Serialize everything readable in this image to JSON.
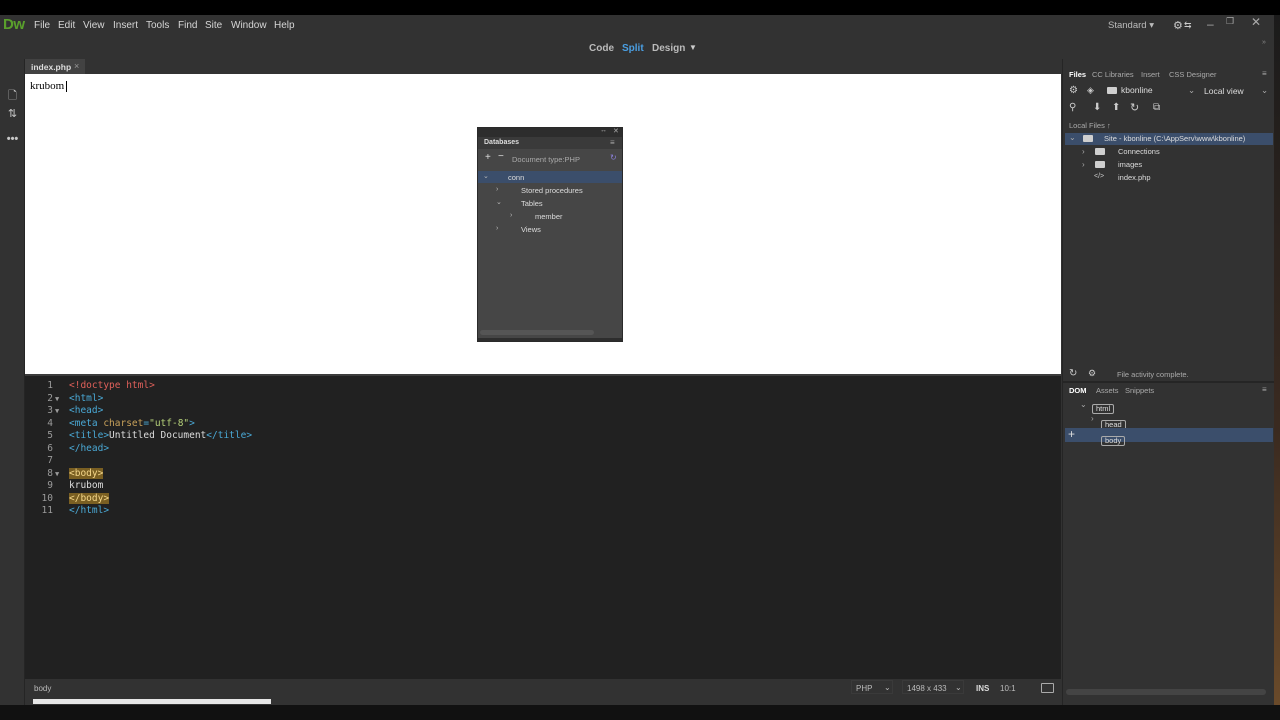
{
  "app": {
    "logo": "Dw"
  },
  "menu": [
    "File",
    "Edit",
    "View",
    "Insert",
    "Tools",
    "Find",
    "Site",
    "Window",
    "Help"
  ],
  "workspace": "Standard",
  "viewbar": {
    "code": "Code",
    "split": "Split",
    "design": "Design"
  },
  "doc_tab": {
    "name": "index.php",
    "close": "×"
  },
  "design_text": "krubom",
  "db_panel": {
    "title": "Databases",
    "doc_type": "Document type:PHP",
    "rows": [
      {
        "label": "conn",
        "depth": 0,
        "expanded": true
      },
      {
        "label": "Stored procedures",
        "depth": 1,
        "expanded": false
      },
      {
        "label": "Tables",
        "depth": 1,
        "expanded": true
      },
      {
        "label": "member",
        "depth": 2,
        "expanded": false
      },
      {
        "label": "Views",
        "depth": 1,
        "expanded": false
      }
    ]
  },
  "code_lines": [
    "1",
    "2",
    "3",
    "4",
    "5",
    "6",
    "7",
    "8",
    "9",
    "10",
    "11"
  ],
  "code": {
    "l1": "<!doctype html>",
    "l2": "<html>",
    "l3": "<head>",
    "l4a": "<meta ",
    "l4b": "charset",
    "l4c": "=",
    "l4d": "\"utf-8\"",
    "l4e": ">",
    "l5a": "<title>",
    "l5b": "Untitled Document",
    "l5c": "</title>",
    "l6": "</head>",
    "l8": "<body>",
    "l9": "krubom",
    "l10": "</body>",
    "l11": "</html>"
  },
  "status": {
    "tag": "body",
    "lang": "PHP",
    "size": "1498 x 433",
    "mode": "INS",
    "pos": "10:1"
  },
  "files_panel": {
    "tabs": [
      "Files",
      "CC Libraries",
      "Insert",
      "CSS Designer"
    ],
    "site": "kbonline",
    "view": "Local view",
    "local_files_label": "Local Files",
    "tree": [
      {
        "label": "Site - kbonline (C:\\AppServ\\www\\kbonline)",
        "depth": 0,
        "type": "site"
      },
      {
        "label": "Connections",
        "depth": 1,
        "type": "folder"
      },
      {
        "label": "images",
        "depth": 1,
        "type": "folder"
      },
      {
        "label": "index.php",
        "depth": 1,
        "type": "file"
      }
    ],
    "activity": "File activity complete."
  },
  "dom_panel": {
    "tabs": [
      "DOM",
      "Assets",
      "Snippets"
    ],
    "nodes": [
      "html",
      "head",
      "body"
    ]
  }
}
